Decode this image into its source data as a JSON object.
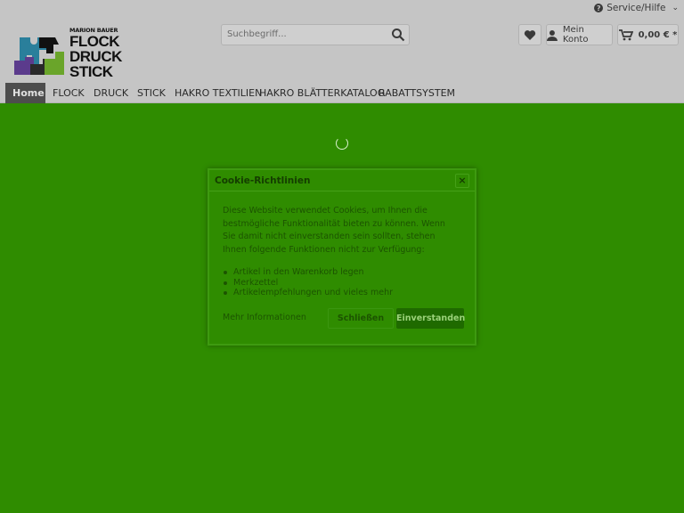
{
  "colors": {
    "overlay_green": "#2f8c00",
    "header_bg": "#c5c5c5",
    "nav_active_bg": "#4d4d4d",
    "accept_btn": "#1f6a00"
  },
  "header": {
    "service_label": "Service/Hilfe",
    "logo": {
      "small": "MARION BAUER",
      "line1": "FLOCK",
      "line2": "DRUCK",
      "line3": "STICK"
    },
    "search_placeholder": "Suchbegriff...",
    "account_label": "Mein Konto",
    "cart_label": "0,00 € *",
    "icons": {
      "service": "question-circle-icon",
      "search": "search-icon",
      "wishlist": "heart-icon",
      "account": "user-icon",
      "cart": "cart-icon"
    }
  },
  "nav": {
    "items": [
      "Home",
      "FLOCK",
      "DRUCK",
      "STICK",
      "HAKRO TEXTILIEN",
      "HAKRO BLÄTTERKATALOG",
      "RABATTSYSTEM"
    ],
    "active": "Home"
  },
  "cookie_modal": {
    "title": "Cookie-Richtlinien",
    "close_symbol": "×",
    "text": "Diese Website verwendet Cookies, um Ihnen die bestmögliche Funktionalität bieten zu können. Wenn Sie damit nicht einverstanden sein sollten, stehen Ihnen folgende Funktionen nicht zur Verfügung:",
    "list": [
      "Artikel in den Warenkorb legen",
      "Merkzettel",
      "Artikelempfehlungen und vieles mehr"
    ],
    "more_info": "Mehr Informationen",
    "close_button": "Schließen",
    "accept_button": "Einverstanden"
  }
}
